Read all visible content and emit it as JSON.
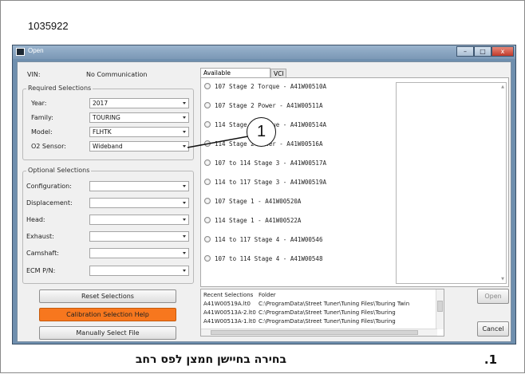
{
  "figure_number": "1035922",
  "window": {
    "title": "Open",
    "controls": {
      "minimize": "–",
      "maximize": "□",
      "close": "x"
    }
  },
  "vin": {
    "label": "VIN:",
    "value": "No Communication"
  },
  "required": {
    "caption": "Required Selections",
    "fields": [
      {
        "label": "Year:",
        "value": "2017"
      },
      {
        "label": "Family:",
        "value": "TOURING"
      },
      {
        "label": "Model:",
        "value": "FLHTK"
      },
      {
        "label": "O2 Sensor:",
        "value": "Wideband"
      }
    ]
  },
  "optional": {
    "caption": "Optional Selections",
    "fields": [
      {
        "label": "Configuration:",
        "value": ""
      },
      {
        "label": "Displacement:",
        "value": ""
      },
      {
        "label": "Head:",
        "value": ""
      },
      {
        "label": "Exhaust:",
        "value": ""
      },
      {
        "label": "Camshaft:",
        "value": ""
      },
      {
        "label": "ECM P/N:",
        "value": ""
      }
    ]
  },
  "buttons": {
    "reset": "Reset Selections",
    "help": "Calibration Selection Help",
    "manual": "Manually Select File",
    "open": "Open",
    "cancel": "Cancel"
  },
  "tabs": [
    {
      "label": "Available Calibrations",
      "active": true
    },
    {
      "label": "VCI",
      "active": false
    }
  ],
  "calibrations": [
    "107 Stage 2 Torque - A41W00510A",
    "107 Stage 2 Power - A41W00511A",
    "114 Stage 2 Torque - A41W00514A",
    "114 Stage 2 Power - A41W00516A",
    "107 to 114 Stage 3 - A41W00517A",
    "114 to 117 Stage 3 - A41W00519A",
    "107 Stage 1 - A41W00520A",
    "114 Stage 1 - A41W00522A",
    "114 to 117 Stage 4 - A41W00546",
    "107 to 114 Stage 4 - A41W00548"
  ],
  "recent": {
    "headers": [
      "Recent Selections",
      "Folder"
    ],
    "rows": [
      {
        "file": "A41W00519A.lt0",
        "folder": "C:\\ProgramData\\Street Tuner\\Tuning Files\\Touring Twin"
      },
      {
        "file": "A41W00513A-2.lt0",
        "folder": "C:\\ProgramData\\Street Tuner\\Tuning Files\\Touring"
      },
      {
        "file": "A41W00513A-1.lt0",
        "folder": "C:\\ProgramData\\Street Tuner\\Tuning Files\\Touring"
      }
    ]
  },
  "callout": {
    "number": "1"
  },
  "caption": {
    "number": "1.",
    "text": "בחירה בחיישן חמצן לפס רחב"
  }
}
